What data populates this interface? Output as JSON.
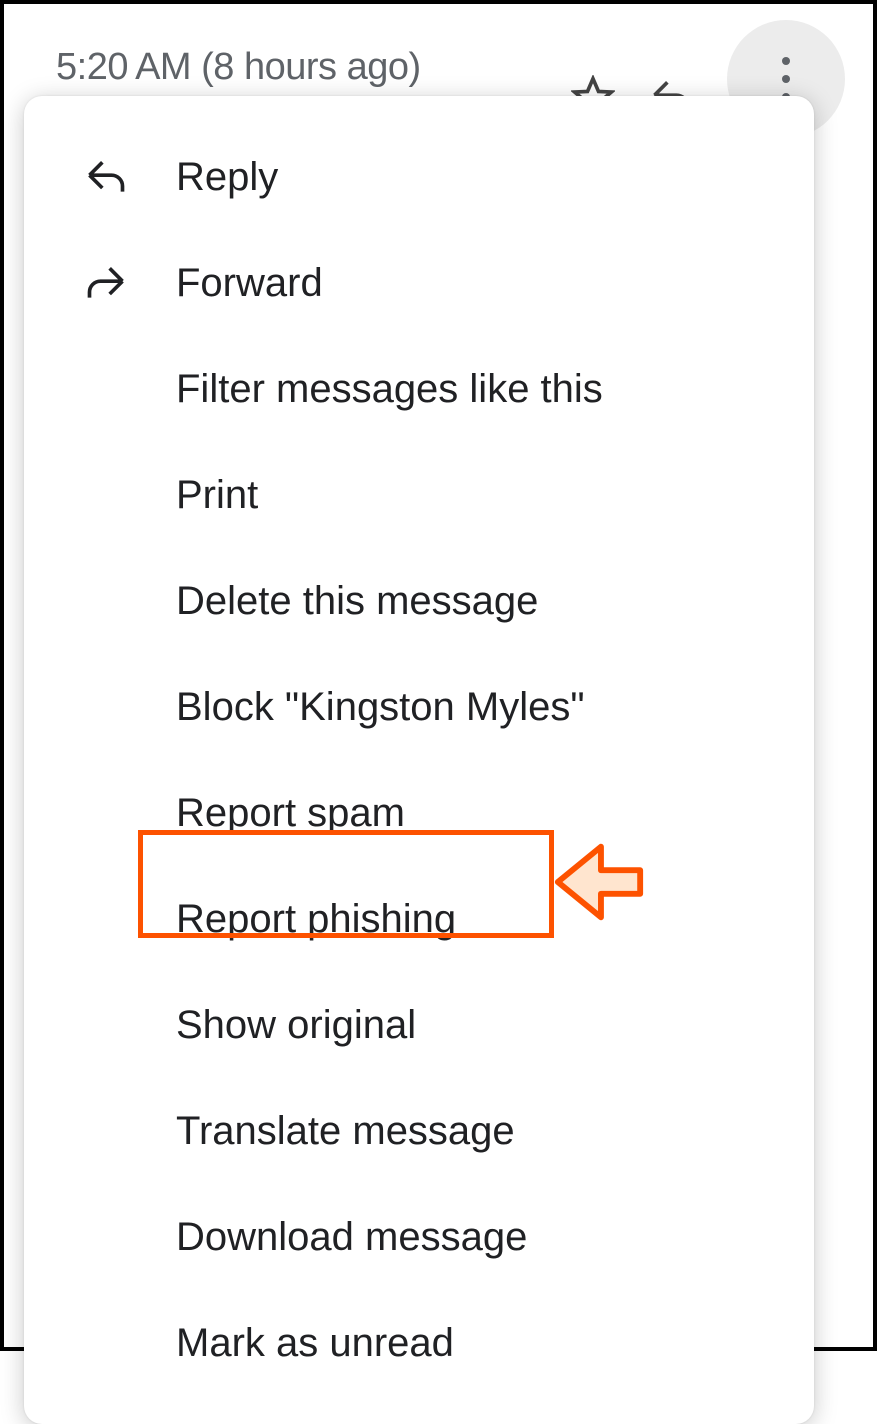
{
  "header": {
    "timestamp": "5:20 AM (8 hours ago)"
  },
  "menu": {
    "reply": "Reply",
    "forward": "Forward",
    "filter": "Filter messages like this",
    "print": "Print",
    "delete": "Delete this message",
    "block": "Block \"Kingston Myles\"",
    "report_spam": "Report spam",
    "report_phishing": "Report phishing",
    "show_original": "Show original",
    "translate": "Translate message",
    "download": "Download message",
    "mark_unread": "Mark as unread"
  }
}
